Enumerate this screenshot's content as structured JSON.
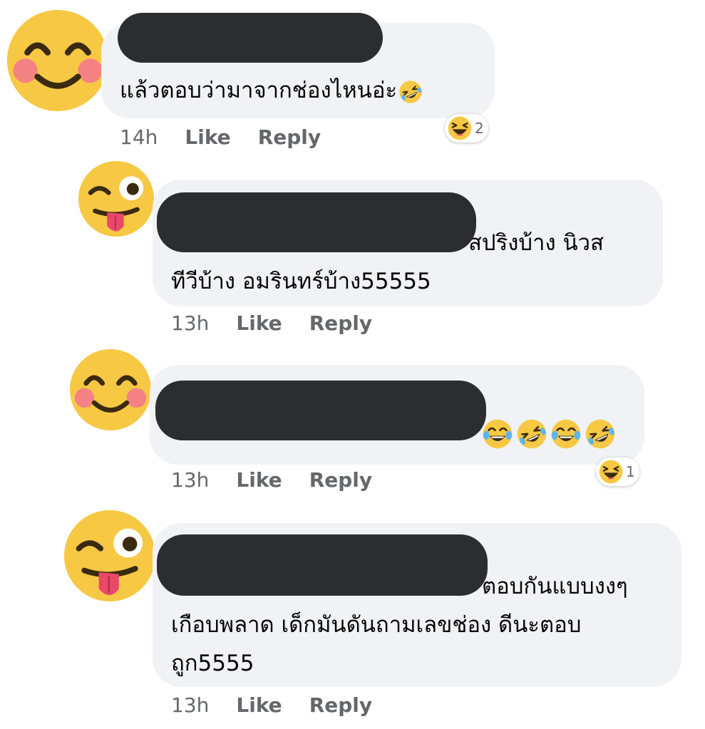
{
  "comments": [
    {
      "avatar_icon": "smiling-face-blush-icon",
      "text_lines": [
        "แล้วตอบว่ามาจากช่องไหนอ่ะ"
      ],
      "trailing_emojis": [
        "rolling-on-floor-laughing-icon"
      ],
      "time": "14h",
      "like_label": "Like",
      "reply_label": "Reply",
      "reaction_count": "2"
    },
    {
      "avatar_icon": "winking-tongue-face-icon",
      "text_lines": [
        "ง สปริงบ้าง นิวส",
        "ทีวีบ้าง อมรินทร์บ้าง55555"
      ],
      "time": "13h",
      "like_label": "Like",
      "reply_label": "Reply"
    },
    {
      "avatar_icon": "smiling-face-blush-icon",
      "trailing_emojis": [
        "tears-of-joy-icon",
        "rolling-on-floor-laughing-icon",
        "tears-of-joy-icon",
        "rolling-on-floor-laughing-icon"
      ],
      "time": "13h",
      "like_label": "Like",
      "reply_label": "Reply",
      "reaction_count": "1"
    },
    {
      "avatar_icon": "winking-tongue-face-icon",
      "text_lines": [
        "ตอบกันแบบงงๆ",
        "เกือบพลาด เด็กมันดันถามเลขช่อง ดีนะตอบ",
        "ถูก5555"
      ],
      "time": "13h",
      "like_label": "Like",
      "reply_label": "Reply"
    }
  ],
  "colors": {
    "bubble": "#f0f2f5",
    "redaction": "#2b2d31",
    "avatar_yellow": "#f6c844",
    "meta_gray": "#65676b"
  }
}
